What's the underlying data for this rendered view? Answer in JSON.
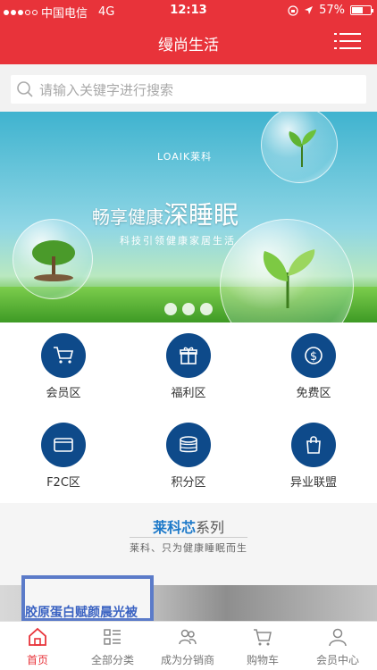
{
  "status_bar": {
    "carrier": "中国电信",
    "network": "4G",
    "time": "12:13",
    "battery": "57%"
  },
  "header": {
    "title": "缦尚生活",
    "menu_icon": "menu-icon"
  },
  "search": {
    "placeholder": "请输入关键字进行搜索"
  },
  "banner": {
    "brand": "LOAIK莱科",
    "slogan_prefix": "畅享健康",
    "slogan_highlight": "深睡眠",
    "subtitle": "科技引领健康家居生活",
    "slide_count": 3
  },
  "categories": [
    {
      "label": "会员区",
      "icon": "cart-icon"
    },
    {
      "label": "福利区",
      "icon": "gift-icon"
    },
    {
      "label": "免费区",
      "icon": "dollar-icon"
    },
    {
      "label": "F2C区",
      "icon": "card-icon"
    },
    {
      "label": "积分区",
      "icon": "coins-icon"
    },
    {
      "label": "异业联盟",
      "icon": "bag-icon"
    }
  ],
  "series": {
    "title_highlight": "莱科芯",
    "title_rest": "系列",
    "subtitle": "莱科、只为健康睡眠而生"
  },
  "promo": {
    "text": "胶原蛋白赋颜晨光被"
  },
  "tabbar": [
    {
      "label": "首页",
      "icon": "home-icon",
      "active": true
    },
    {
      "label": "全部分类",
      "icon": "list-icon",
      "active": false
    },
    {
      "label": "成为分销商",
      "icon": "users-icon",
      "active": false
    },
    {
      "label": "购物车",
      "icon": "cart-icon",
      "active": false
    },
    {
      "label": "会员中心",
      "icon": "user-icon",
      "active": false
    }
  ],
  "colors": {
    "brand_red": "#e8333a",
    "icon_blue": "#0e4a8a",
    "series_blue": "#1e7ac9"
  }
}
